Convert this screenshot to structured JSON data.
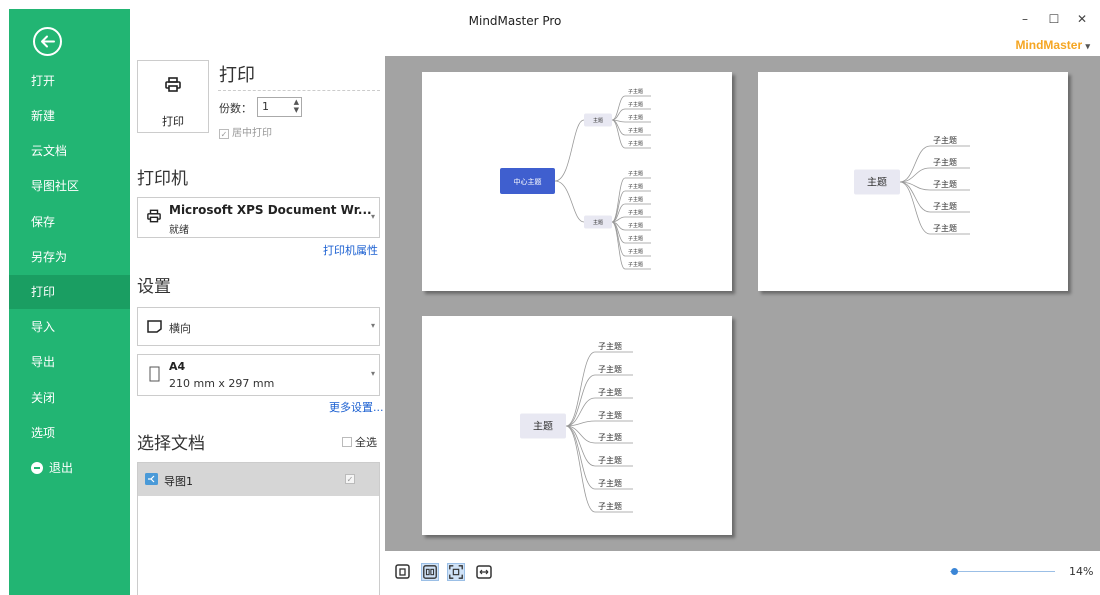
{
  "window": {
    "title": "MindMaster Pro",
    "brand": "MindMaster",
    "brand_caret": "▾",
    "controls": {
      "minimize": "–",
      "maximize": "☐",
      "close": "✕"
    }
  },
  "sidebar": {
    "back_icon": "arrow-left-circle-icon",
    "items": [
      {
        "label": "打开"
      },
      {
        "label": "新建"
      },
      {
        "label": "云文档"
      },
      {
        "label": "导图社区"
      },
      {
        "label": "保存"
      },
      {
        "label": "另存为"
      },
      {
        "label": "打印",
        "active": true
      },
      {
        "label": "导入"
      },
      {
        "label": "导出"
      },
      {
        "label": "关闭"
      },
      {
        "label": "选项"
      },
      {
        "label": "退出",
        "icon": "minus-circle-icon"
      }
    ]
  },
  "print": {
    "heading": "打印",
    "button_label": "打印",
    "copies_label": "份数：",
    "copies_value": "1",
    "center_label": "居中打印",
    "center_checked": true
  },
  "printer": {
    "heading": "打印机",
    "name": "Microsoft XPS Document Wr...",
    "status": "就绪",
    "properties_link": "打印机属性"
  },
  "settings": {
    "heading": "设置",
    "orientation": "横向",
    "paper_name": "A4",
    "paper_size": "210 mm x 297 mm",
    "more_link": "更多设置..."
  },
  "documents": {
    "heading": "选择文档",
    "select_all_label": "全选",
    "select_all_checked": false,
    "items": [
      {
        "name": "导图1",
        "checked": true
      }
    ]
  },
  "preview": {
    "page1": {
      "center": "中心主题",
      "branches": [
        {
          "label": "主题",
          "children": [
            "子主题",
            "子主题",
            "子主题",
            "子主题",
            "子主题"
          ]
        },
        {
          "label": "主题",
          "children": [
            "子主题",
            "子主题",
            "子主题",
            "子主题",
            "子主题",
            "子主题",
            "子主题",
            "子主题"
          ]
        }
      ]
    },
    "page2": {
      "topic": "主题",
      "children": [
        "子主题",
        "子主题",
        "子主题",
        "子主题",
        "子主题"
      ]
    },
    "page3": {
      "topic": "主题",
      "children": [
        "子主题",
        "子主题",
        "子主题",
        "子主题",
        "子主题",
        "子主题",
        "子主题",
        "子主题"
      ]
    }
  },
  "footer": {
    "view_buttons": [
      "single-page-icon",
      "two-page-icon",
      "fit-page-icon",
      "fit-width-icon"
    ],
    "zoom": "14%",
    "zoom_level": 0.14
  },
  "colors": {
    "sidebar": "#22b573",
    "sidebar_active": "#1a9e62",
    "brand": "#f5a623",
    "link": "#1a5fd1",
    "center_topic": "#3f5fcf",
    "preview_bg": "#a3a3a3"
  }
}
